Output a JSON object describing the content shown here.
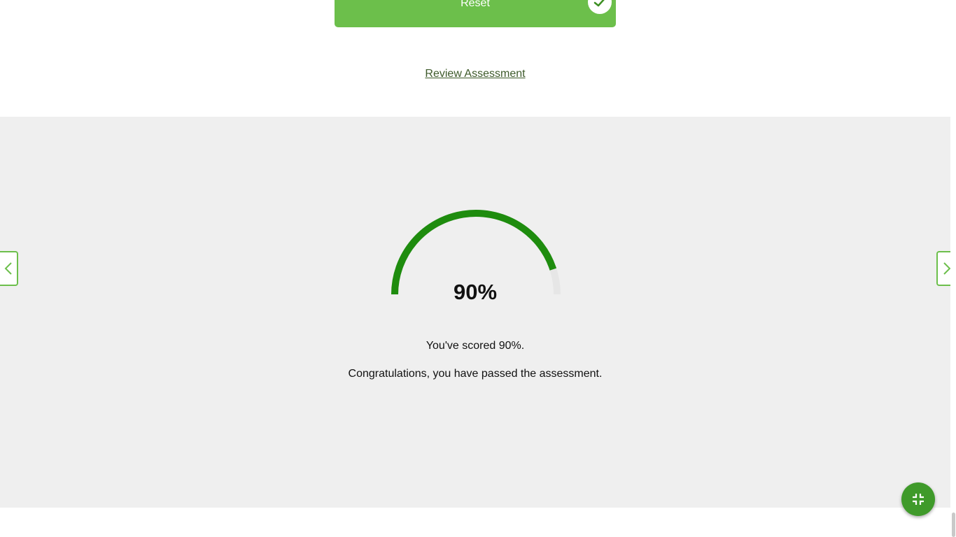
{
  "reset_button": {
    "label": "Reset",
    "icon": "check-icon"
  },
  "review_link": {
    "label": "Review Assessment"
  },
  "result": {
    "score_display": "90%",
    "score_fraction": 0.9,
    "score_message": "You've scored 90%.",
    "pass_message": "Congratulations, you have passed the assessment."
  },
  "navigation": {
    "prev_icon": "chevron-left-icon",
    "next_icon": "chevron-right-icon"
  },
  "fab": {
    "icon": "collapse-icon"
  },
  "colors": {
    "accent": "#6cbf4b",
    "gauge": "#1e8c0e",
    "panel_bg": "#efefef",
    "link": "#3d5a2a"
  }
}
